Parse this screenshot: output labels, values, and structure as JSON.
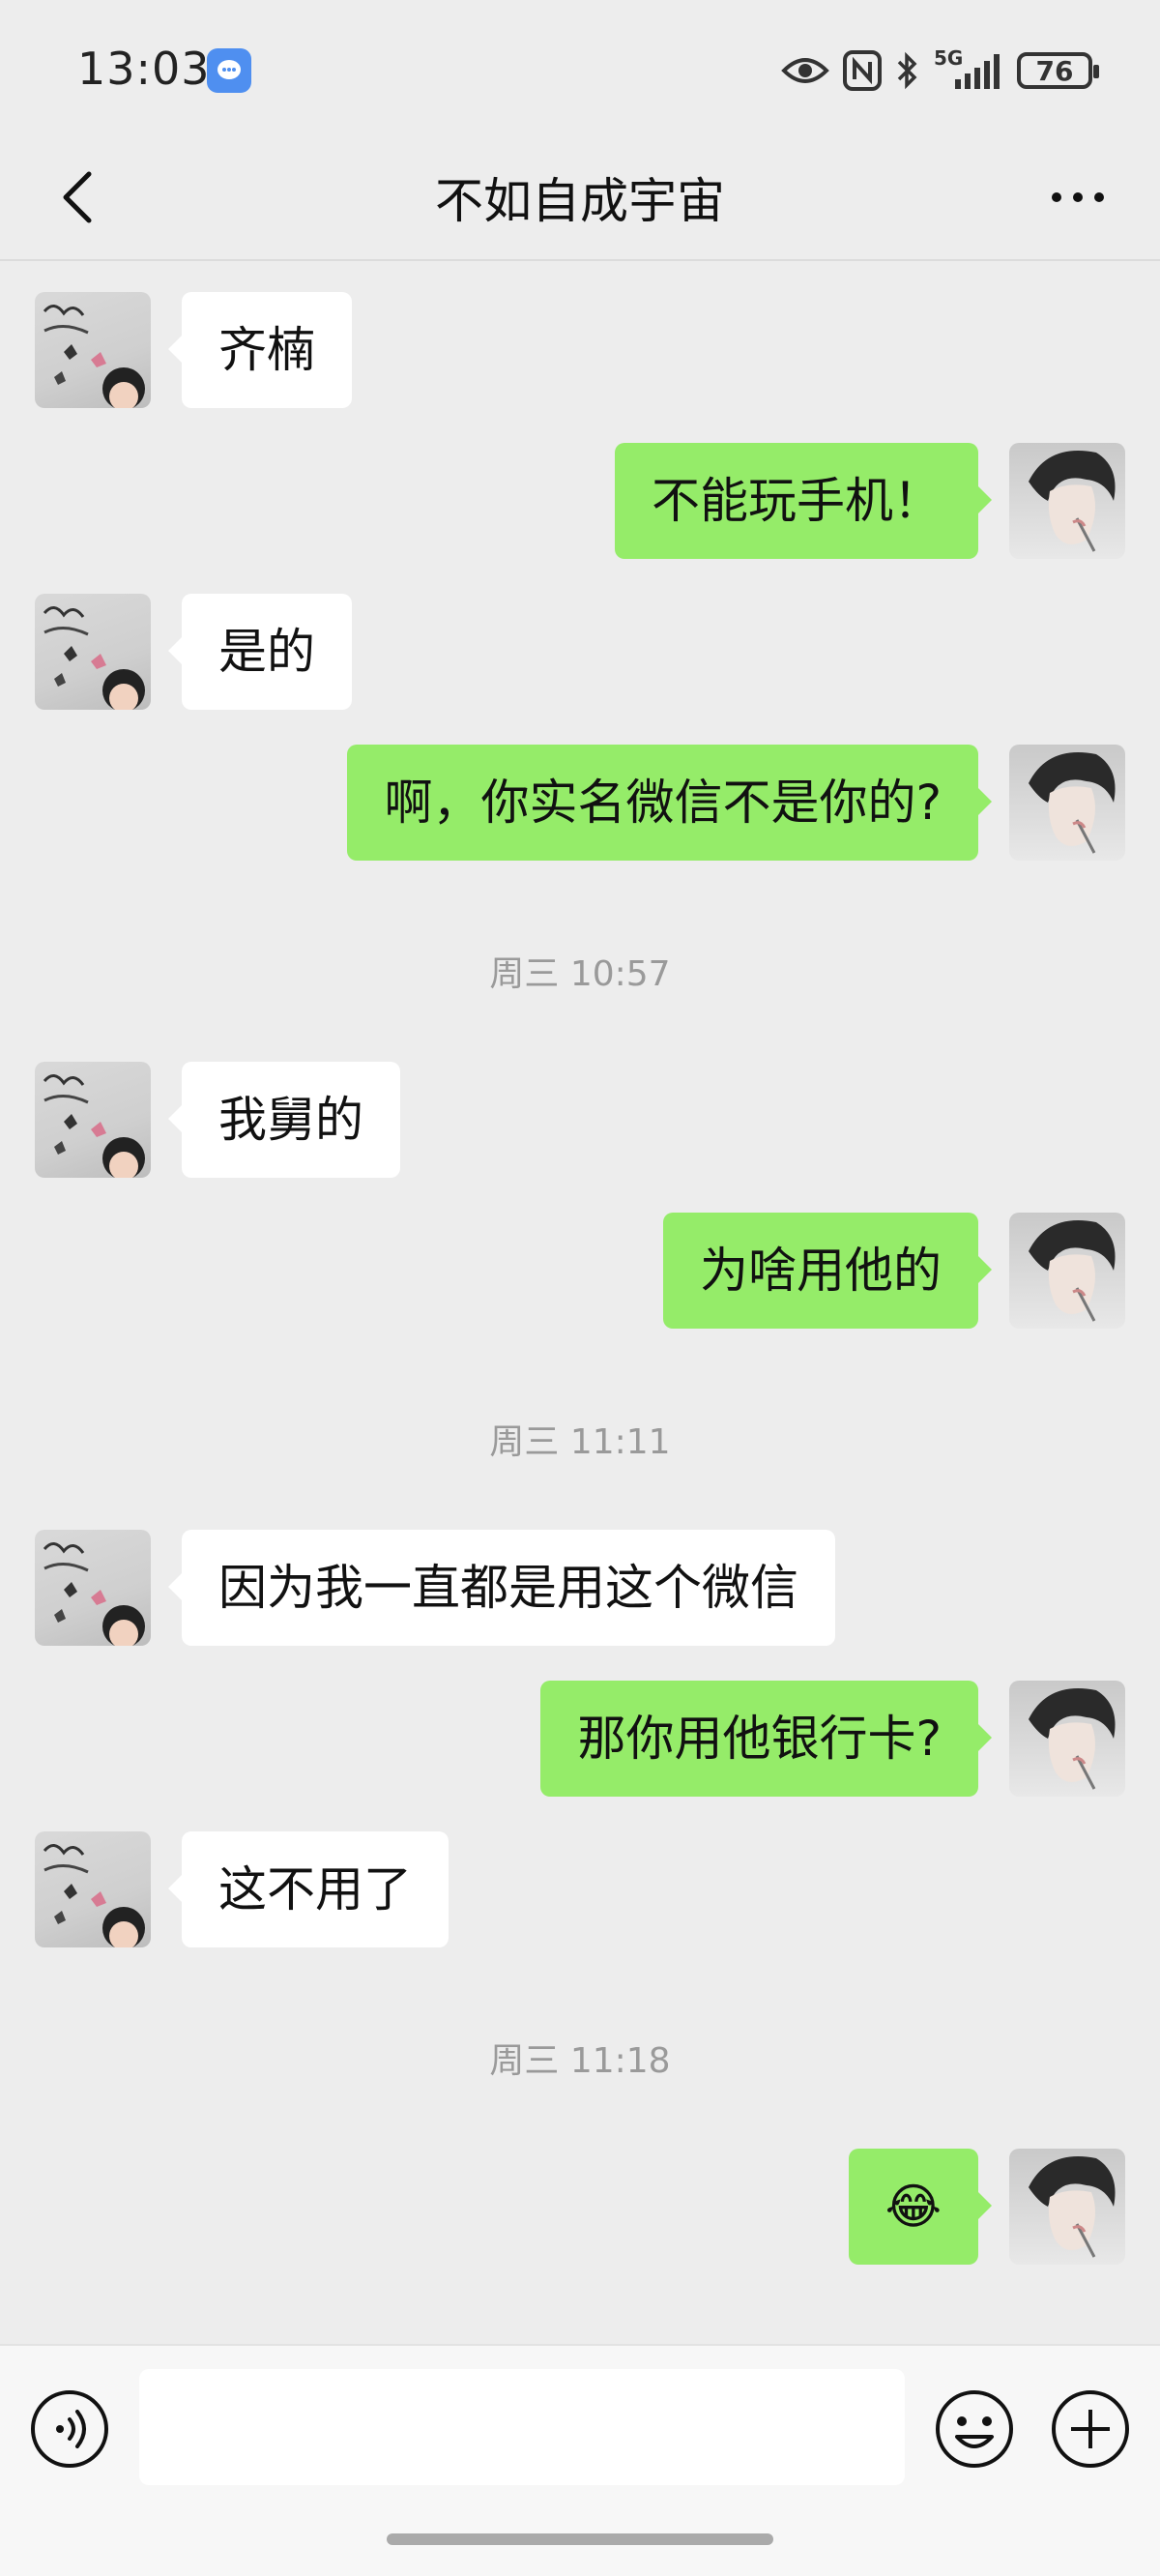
{
  "status_bar": {
    "time": "13:03",
    "network": "5G",
    "battery": "76"
  },
  "header": {
    "title": "不如自成宇宙"
  },
  "messages": [
    {
      "side": "left",
      "text": "齐楠"
    },
    {
      "side": "right",
      "text": "不能玩手机！"
    },
    {
      "side": "left",
      "text": "是的"
    },
    {
      "side": "right",
      "text": "啊，你实名微信不是你的?"
    },
    {
      "type": "time",
      "text": "周三 10:57"
    },
    {
      "side": "left",
      "text": "我舅的"
    },
    {
      "side": "right",
      "text": "为啥用他的"
    },
    {
      "type": "time",
      "text": "周三 11:11"
    },
    {
      "side": "left",
      "text": "因为我一直都是用这个微信"
    },
    {
      "side": "right",
      "text": "那你用他银行卡?"
    },
    {
      "side": "left",
      "text": "这不用了"
    },
    {
      "type": "time",
      "text": "周三 11:18"
    },
    {
      "side": "right",
      "text": "😂"
    }
  ],
  "colors": {
    "background": "#ededed",
    "sent_bubble": "#95ec69",
    "received_bubble": "#ffffff"
  }
}
